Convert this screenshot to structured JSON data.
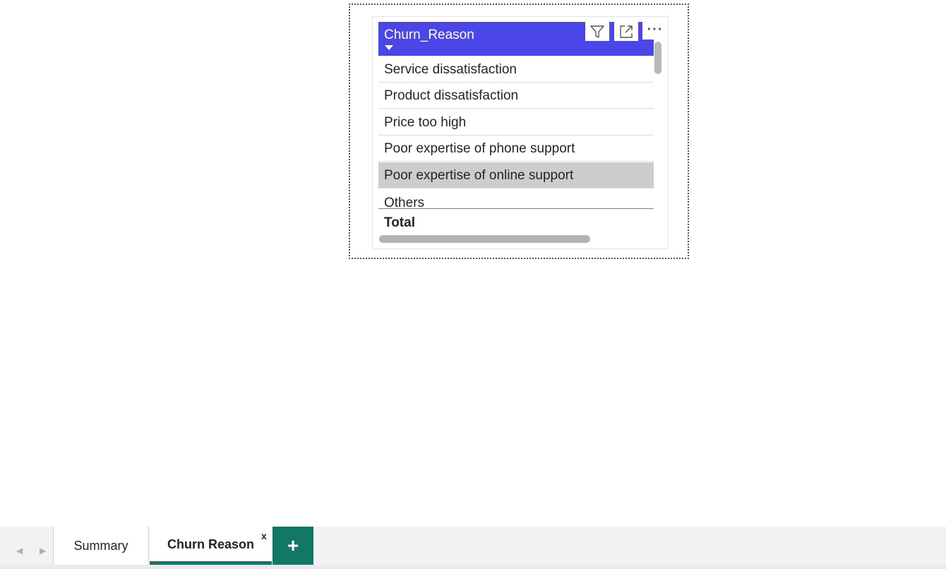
{
  "colors": {
    "accent": "#4a46e8",
    "tab_accent": "#117865",
    "selected_row": "#cdcdcd"
  },
  "visual": {
    "header": {
      "label": "Churn_Reason",
      "sort_icon": "sort-descending-icon"
    },
    "header_buttons": [
      {
        "icon": "filter-icon"
      },
      {
        "icon": "focus-mode-icon"
      },
      {
        "icon": "more-options-icon",
        "label": "···"
      }
    ],
    "rows": [
      {
        "label": "Service dissatisfaction",
        "selected": false
      },
      {
        "label": "Product dissatisfaction",
        "selected": false
      },
      {
        "label": "Price too high",
        "selected": false
      },
      {
        "label": "Poor expertise of phone support",
        "selected": false
      },
      {
        "label": "Poor expertise of online support",
        "selected": true
      },
      {
        "label": "Others",
        "selected": false
      }
    ],
    "total_label": "Total"
  },
  "tabs": {
    "items": [
      {
        "label": "Summary",
        "active": false
      },
      {
        "label": "Churn Reason",
        "active": true
      }
    ],
    "close_label": "x",
    "add_label": "+",
    "prev_icon": "chevron-left-icon",
    "next_icon": "chevron-right-icon"
  }
}
